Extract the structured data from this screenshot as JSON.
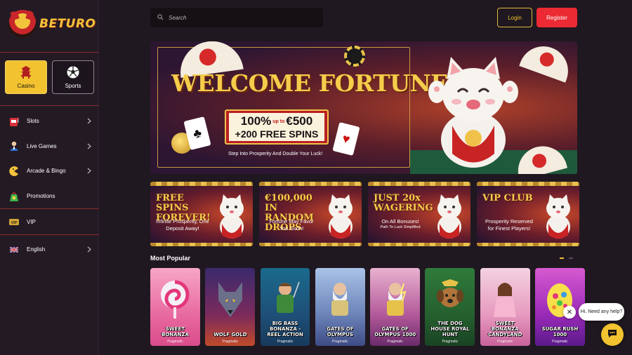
{
  "brand": {
    "name": "BETURO"
  },
  "search": {
    "placeholder": "Search"
  },
  "auth": {
    "login_label": "Login",
    "register_label": "Register"
  },
  "categories": [
    {
      "label": "Casino",
      "icon": "pagoda-icon",
      "active": true
    },
    {
      "label": "Sports",
      "icon": "soccer-ball-icon",
      "active": false
    }
  ],
  "sidebar": {
    "items": [
      {
        "label": "Slots",
        "icon": "slot-machine-icon"
      },
      {
        "label": "Live Games",
        "icon": "dealer-icon"
      },
      {
        "label": "Arcade & Bingo",
        "icon": "pacman-icon"
      },
      {
        "label": "Promotions",
        "icon": "gift-bag-icon"
      },
      {
        "label": "VIP",
        "icon": "vip-card-icon"
      }
    ],
    "language": {
      "label": "English",
      "icon": "uk-flag-icon"
    }
  },
  "hero": {
    "title": "WELCOME FORTUNE",
    "offer_percent": "100%",
    "offer_upto": "up to",
    "offer_amount": "€500",
    "offer_spins": "+200 FREE SPINS",
    "subtitle": "Step Into Prosperity And Double Your Luck!"
  },
  "promos": [
    {
      "title": "FREE SPINS FOREVER!",
      "text": "Infinite Prosperity, One Deposit Away!",
      "small": ""
    },
    {
      "title": "€100,000 IN RANDOM DROPS",
      "text": "Fortune May Favor You Soon!",
      "small": ""
    },
    {
      "title": "JUST 20x WAGERING",
      "text": "On All Bonuses!",
      "small": "Path To Luck Simplified"
    },
    {
      "title": "VIP CLUB",
      "text": "Prosperity Reserved for Finest Players!",
      "small": ""
    }
  ],
  "popular": {
    "title": "Most Popular",
    "games": [
      {
        "name": "SWEET BONANZA",
        "provider": "Pragmatic"
      },
      {
        "name": "WOLF GOLD",
        "provider": "Pragmatic"
      },
      {
        "name": "BIG BASS BONANZA - REEL ACTION",
        "provider": "Pragmatic"
      },
      {
        "name": "GATES OF OLYMPUS",
        "provider": "Pragmatic"
      },
      {
        "name": "GATES OF OLYMPUS 1000",
        "provider": "Pragmatic"
      },
      {
        "name": "THE DOG HOUSE ROYAL HUNT",
        "provider": "Pragmatic"
      },
      {
        "name": "SWEET BONANZA CANDYLAND",
        "provider": "Pragmatic"
      },
      {
        "name": "SUGAR RUSH 1000",
        "provider": "Pragmatic"
      }
    ]
  },
  "chat": {
    "prompt": "Hi. Need any help?"
  },
  "colors": {
    "accent": "#f2c230",
    "register": "#ec2a33",
    "background": "#1f1820",
    "sidebar": "#231a24"
  }
}
